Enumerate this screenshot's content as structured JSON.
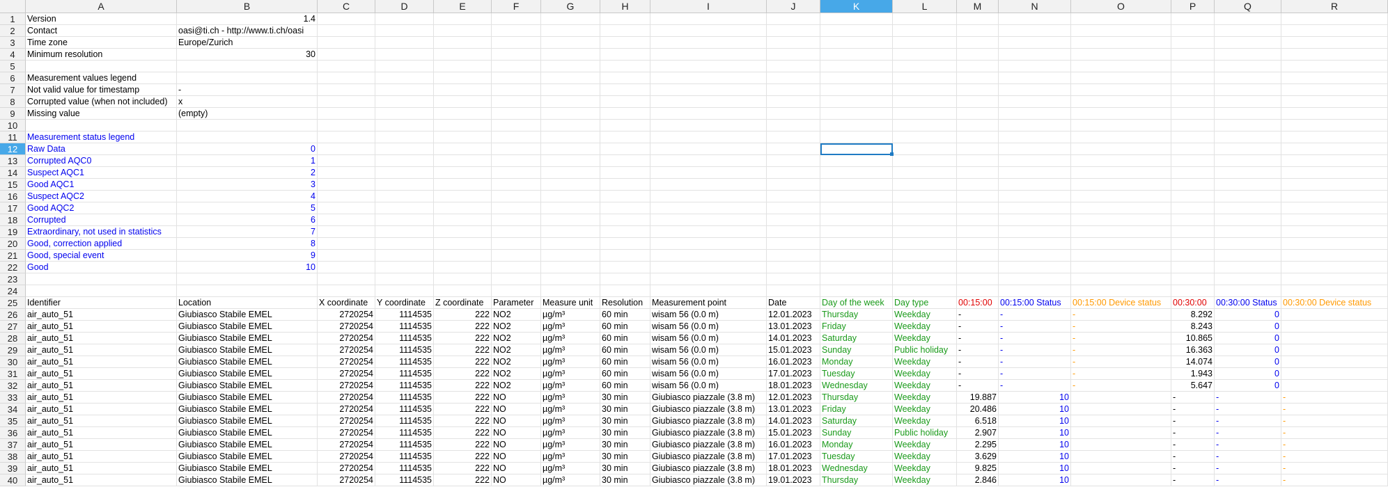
{
  "columns": [
    "A",
    "B",
    "C",
    "D",
    "E",
    "F",
    "G",
    "H",
    "I",
    "J",
    "K",
    "L",
    "M",
    "N",
    "O",
    "P",
    "Q",
    "R"
  ],
  "selected_column": "K",
  "selected_row": 12,
  "row_numbers": [
    1,
    2,
    3,
    4,
    5,
    6,
    7,
    8,
    9,
    10,
    11,
    12,
    13,
    14,
    15,
    16,
    17,
    18,
    19,
    20,
    21,
    22,
    23,
    24,
    25,
    26,
    27,
    28,
    29,
    30,
    31,
    32,
    33,
    34,
    35,
    36,
    37,
    38,
    39,
    40
  ],
  "meta": {
    "version_label": "Version",
    "version_value": "1.4",
    "contact_label": "Contact",
    "contact_value": "oasi@ti.ch - http://www.ti.ch/oasi",
    "timezone_label": "Time zone",
    "timezone_value": "Europe/Zurich",
    "minres_label": "Minimum resolution",
    "minres_value": "30"
  },
  "values_legend": {
    "title": "Measurement values legend",
    "items": [
      {
        "label": "Not valid value for timestamp",
        "symbol": "-"
      },
      {
        "label": "Corrupted value (when not included)",
        "symbol": "x"
      },
      {
        "label": "Missing value",
        "symbol": "(empty)"
      }
    ]
  },
  "status_legend": {
    "title": "Measurement status legend",
    "items": [
      {
        "label": "Raw Data",
        "code": "0"
      },
      {
        "label": "Corrupted AQC0",
        "code": "1"
      },
      {
        "label": "Suspect AQC1",
        "code": "2"
      },
      {
        "label": "Good AQC1",
        "code": "3"
      },
      {
        "label": "Suspect AQC2",
        "code": "4"
      },
      {
        "label": "Good AQC2",
        "code": "5"
      },
      {
        "label": "Corrupted",
        "code": "6"
      },
      {
        "label": "Extraordinary, not used in statistics",
        "code": "7"
      },
      {
        "label": "Good, correction applied",
        "code": "8"
      },
      {
        "label": "Good, special event",
        "code": "9"
      },
      {
        "label": "Good",
        "code": "10"
      }
    ]
  },
  "table": {
    "headers": [
      "Identifier",
      "Location",
      "X coordinate",
      "Y coordinate",
      "Z coordinate",
      "Parameter",
      "Measure unit",
      "Resolution",
      "Measurement point",
      "Date",
      "Day of the week",
      "Day type",
      "00:15:00",
      "00:15:00 Status",
      "00:15:00 Device status",
      "00:30:00",
      "00:30:00 Status",
      "00:30:00 Device status"
    ],
    "rows": [
      [
        "air_auto_51",
        "Giubiasco Stabile EMEL",
        "2720254",
        "1114535",
        "222",
        "NO2",
        "µg/m³",
        "60 min",
        "wisam 56 (0.0 m)",
        "12.01.2023",
        "Thursday",
        "Weekday",
        "-",
        "-",
        "-",
        "8.292",
        "0",
        ""
      ],
      [
        "air_auto_51",
        "Giubiasco Stabile EMEL",
        "2720254",
        "1114535",
        "222",
        "NO2",
        "µg/m³",
        "60 min",
        "wisam 56 (0.0 m)",
        "13.01.2023",
        "Friday",
        "Weekday",
        "-",
        "-",
        "-",
        "8.243",
        "0",
        ""
      ],
      [
        "air_auto_51",
        "Giubiasco Stabile EMEL",
        "2720254",
        "1114535",
        "222",
        "NO2",
        "µg/m³",
        "60 min",
        "wisam 56 (0.0 m)",
        "14.01.2023",
        "Saturday",
        "Weekday",
        "-",
        "-",
        "-",
        "10.865",
        "0",
        ""
      ],
      [
        "air_auto_51",
        "Giubiasco Stabile EMEL",
        "2720254",
        "1114535",
        "222",
        "NO2",
        "µg/m³",
        "60 min",
        "wisam 56 (0.0 m)",
        "15.01.2023",
        "Sunday",
        "Public holiday",
        "-",
        "-",
        "-",
        "16.363",
        "0",
        ""
      ],
      [
        "air_auto_51",
        "Giubiasco Stabile EMEL",
        "2720254",
        "1114535",
        "222",
        "NO2",
        "µg/m³",
        "60 min",
        "wisam 56 (0.0 m)",
        "16.01.2023",
        "Monday",
        "Weekday",
        "-",
        "-",
        "-",
        "14.074",
        "0",
        ""
      ],
      [
        "air_auto_51",
        "Giubiasco Stabile EMEL",
        "2720254",
        "1114535",
        "222",
        "NO2",
        "µg/m³",
        "60 min",
        "wisam 56 (0.0 m)",
        "17.01.2023",
        "Tuesday",
        "Weekday",
        "-",
        "-",
        "-",
        "1.943",
        "0",
        ""
      ],
      [
        "air_auto_51",
        "Giubiasco Stabile EMEL",
        "2720254",
        "1114535",
        "222",
        "NO2",
        "µg/m³",
        "60 min",
        "wisam 56 (0.0 m)",
        "18.01.2023",
        "Wednesday",
        "Weekday",
        "-",
        "-",
        "-",
        "5.647",
        "0",
        ""
      ],
      [
        "air_auto_51",
        "Giubiasco Stabile EMEL",
        "2720254",
        "1114535",
        "222",
        "NO",
        "µg/m³",
        "30 min",
        "Giubiasco piazzale (3.8 m)",
        "12.01.2023",
        "Thursday",
        "Weekday",
        "19.887",
        "10",
        "",
        "-",
        "-",
        "-"
      ],
      [
        "air_auto_51",
        "Giubiasco Stabile EMEL",
        "2720254",
        "1114535",
        "222",
        "NO",
        "µg/m³",
        "30 min",
        "Giubiasco piazzale (3.8 m)",
        "13.01.2023",
        "Friday",
        "Weekday",
        "20.486",
        "10",
        "",
        "-",
        "-",
        "-"
      ],
      [
        "air_auto_51",
        "Giubiasco Stabile EMEL",
        "2720254",
        "1114535",
        "222",
        "NO",
        "µg/m³",
        "30 min",
        "Giubiasco piazzale (3.8 m)",
        "14.01.2023",
        "Saturday",
        "Weekday",
        "6.518",
        "10",
        "",
        "-",
        "-",
        "-"
      ],
      [
        "air_auto_51",
        "Giubiasco Stabile EMEL",
        "2720254",
        "1114535",
        "222",
        "NO",
        "µg/m³",
        "30 min",
        "Giubiasco piazzale (3.8 m)",
        "15.01.2023",
        "Sunday",
        "Public holiday",
        "2.907",
        "10",
        "",
        "-",
        "-",
        "-"
      ],
      [
        "air_auto_51",
        "Giubiasco Stabile EMEL",
        "2720254",
        "1114535",
        "222",
        "NO",
        "µg/m³",
        "30 min",
        "Giubiasco piazzale (3.8 m)",
        "16.01.2023",
        "Monday",
        "Weekday",
        "2.295",
        "10",
        "",
        "-",
        "-",
        "-"
      ],
      [
        "air_auto_51",
        "Giubiasco Stabile EMEL",
        "2720254",
        "1114535",
        "222",
        "NO",
        "µg/m³",
        "30 min",
        "Giubiasco piazzale (3.8 m)",
        "17.01.2023",
        "Tuesday",
        "Weekday",
        "3.629",
        "10",
        "",
        "-",
        "-",
        "-"
      ],
      [
        "air_auto_51",
        "Giubiasco Stabile EMEL",
        "2720254",
        "1114535",
        "222",
        "NO",
        "µg/m³",
        "30 min",
        "Giubiasco piazzale (3.8 m)",
        "18.01.2023",
        "Wednesday",
        "Weekday",
        "9.825",
        "10",
        "",
        "-",
        "-",
        "-"
      ],
      [
        "air_auto_51",
        "Giubiasco Stabile EMEL",
        "2720254",
        "1114535",
        "222",
        "NO",
        "µg/m³",
        "30 min",
        "Giubiasco piazzale (3.8 m)",
        "19.01.2023",
        "Thursday",
        "Weekday",
        "2.846",
        "10",
        "",
        "-",
        "-",
        "-"
      ]
    ]
  },
  "colors": {
    "legend_blue": "#0000ee",
    "day_green": "#1a9a1a",
    "value_red": "#e00000",
    "device_orange": "#ff9900",
    "selection_blue": "#47a8e8"
  }
}
